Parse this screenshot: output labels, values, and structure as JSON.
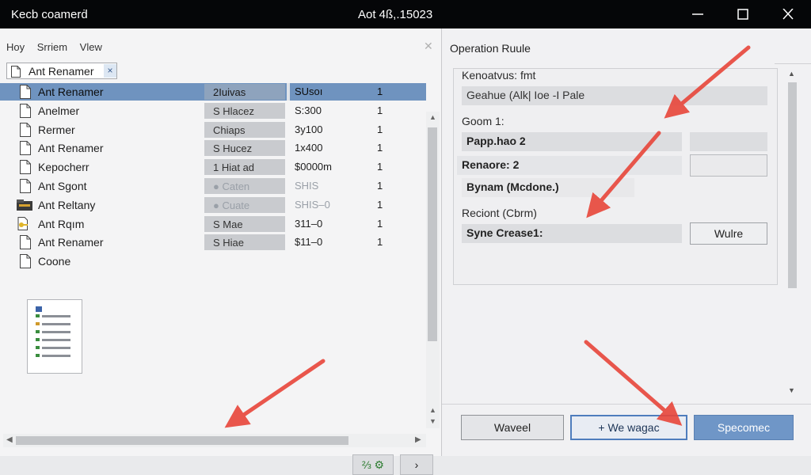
{
  "window": {
    "app_title": "Kecb coamerḋ",
    "doc_title": "Aot 4ß,.15023"
  },
  "menu": [
    "Hoy",
    "Srriem",
    "Vlew"
  ],
  "tab": {
    "label": "Ant Renamer",
    "close": "×"
  },
  "file_rows": [
    {
      "name": "Ant Renamer",
      "tag": "2Iuivas",
      "size": "SUsoı",
      "count": "1",
      "icon": "document-icon",
      "selected": true
    },
    {
      "name": "Anelmer",
      "tag": "S Hlacez",
      "size": "S:300",
      "count": "1",
      "icon": "document-icon"
    },
    {
      "name": "Rermer",
      "tag": "Chiaps",
      "size": "3y100",
      "count": "1",
      "icon": "document-icon"
    },
    {
      "name": "Ant Renamer",
      "tag": "S Hucez",
      "size": "1x400",
      "count": "1",
      "icon": "document-icon"
    },
    {
      "name": "Kepocherr",
      "tag": "1 Hiat ad",
      "size": "$0000m",
      "count": "1",
      "icon": "document-icon"
    },
    {
      "name": "Ant Sgont",
      "tag": "● Caten",
      "size": "SHIS",
      "count": "1",
      "icon": "document-icon",
      "faded": true
    },
    {
      "name": "Ant Reltany",
      "tag": "● Cuate",
      "size": "SHIS–0",
      "count": "1",
      "icon": "folder-tools-icon",
      "faded": true
    },
    {
      "name": "Ant Rqım",
      "tag": "S Mae",
      "size": "311–0",
      "count": "1",
      "icon": "folder-key-icon"
    },
    {
      "name": "Ant Renamer",
      "tag": "S Hiae",
      "size": "$11–0",
      "count": "1",
      "icon": "document-icon"
    },
    {
      "name": "Coone",
      "tag": "",
      "size": "",
      "count": "",
      "icon": "document-icon"
    }
  ],
  "left_bottom_buttons": {
    "refresh": "⅔ ⚙",
    "next": "›"
  },
  "operation": {
    "title": "Operation Ruule",
    "label_1": "Kenoatvus: fmt",
    "field_1": "Geahue (Alk| Ioe -I Pale",
    "label_2": "Goom 1:",
    "field_2": "Papp.hao 2",
    "label_3": "Renaore: 2",
    "field_3": "Bynam (Mcdone.)",
    "label_4": "Reciont (Cbrm)",
    "field_4": "Syne Crease1:",
    "side_button": "Wulre"
  },
  "buttons": {
    "cancel": "Waveel",
    "primary": "+  We wagac",
    "secondary": "Specomec"
  },
  "colors": {
    "titlebar": "#050608",
    "selection": "#6f93bf",
    "primary_border": "#4f7dbd",
    "accent_button": "#6f96c7",
    "annotation_arrow": "#e8463a"
  }
}
